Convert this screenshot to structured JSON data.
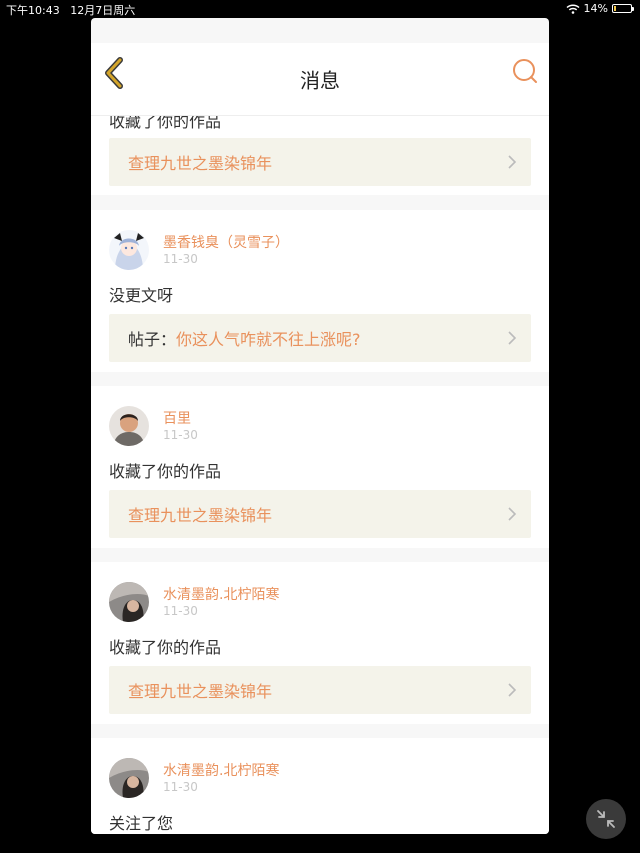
{
  "status_bar": {
    "time": "下午10:43",
    "date": "12月7日周六",
    "battery": "14%",
    "battery_level": 0.14
  },
  "header": {
    "title": "消息"
  },
  "notifications": [
    {
      "text": "收藏了你的作品",
      "ref": {
        "title": "查理九世之墨染锦年"
      }
    },
    {
      "user": "墨香钱臭（灵雪子）",
      "time": "11-30",
      "text": "没更文呀",
      "ref": {
        "prefix": "帖子：",
        "title": "你这人气咋就不往上涨呢?"
      }
    },
    {
      "user": "百里",
      "time": "11-30",
      "text": "收藏了你的作品",
      "ref": {
        "title": "查理九世之墨染锦年"
      }
    },
    {
      "user": "水清墨韵.北柠陌寒",
      "time": "11-30",
      "text": "收藏了你的作品",
      "ref": {
        "title": "查理九世之墨染锦年"
      }
    },
    {
      "user": "水清墨韵.北柠陌寒",
      "time": "11-30",
      "text": "关注了您"
    }
  ],
  "colors": {
    "accent": "#e9915c",
    "ref_bg": "#f4f3ea",
    "back_icon": "#d4a52a"
  }
}
